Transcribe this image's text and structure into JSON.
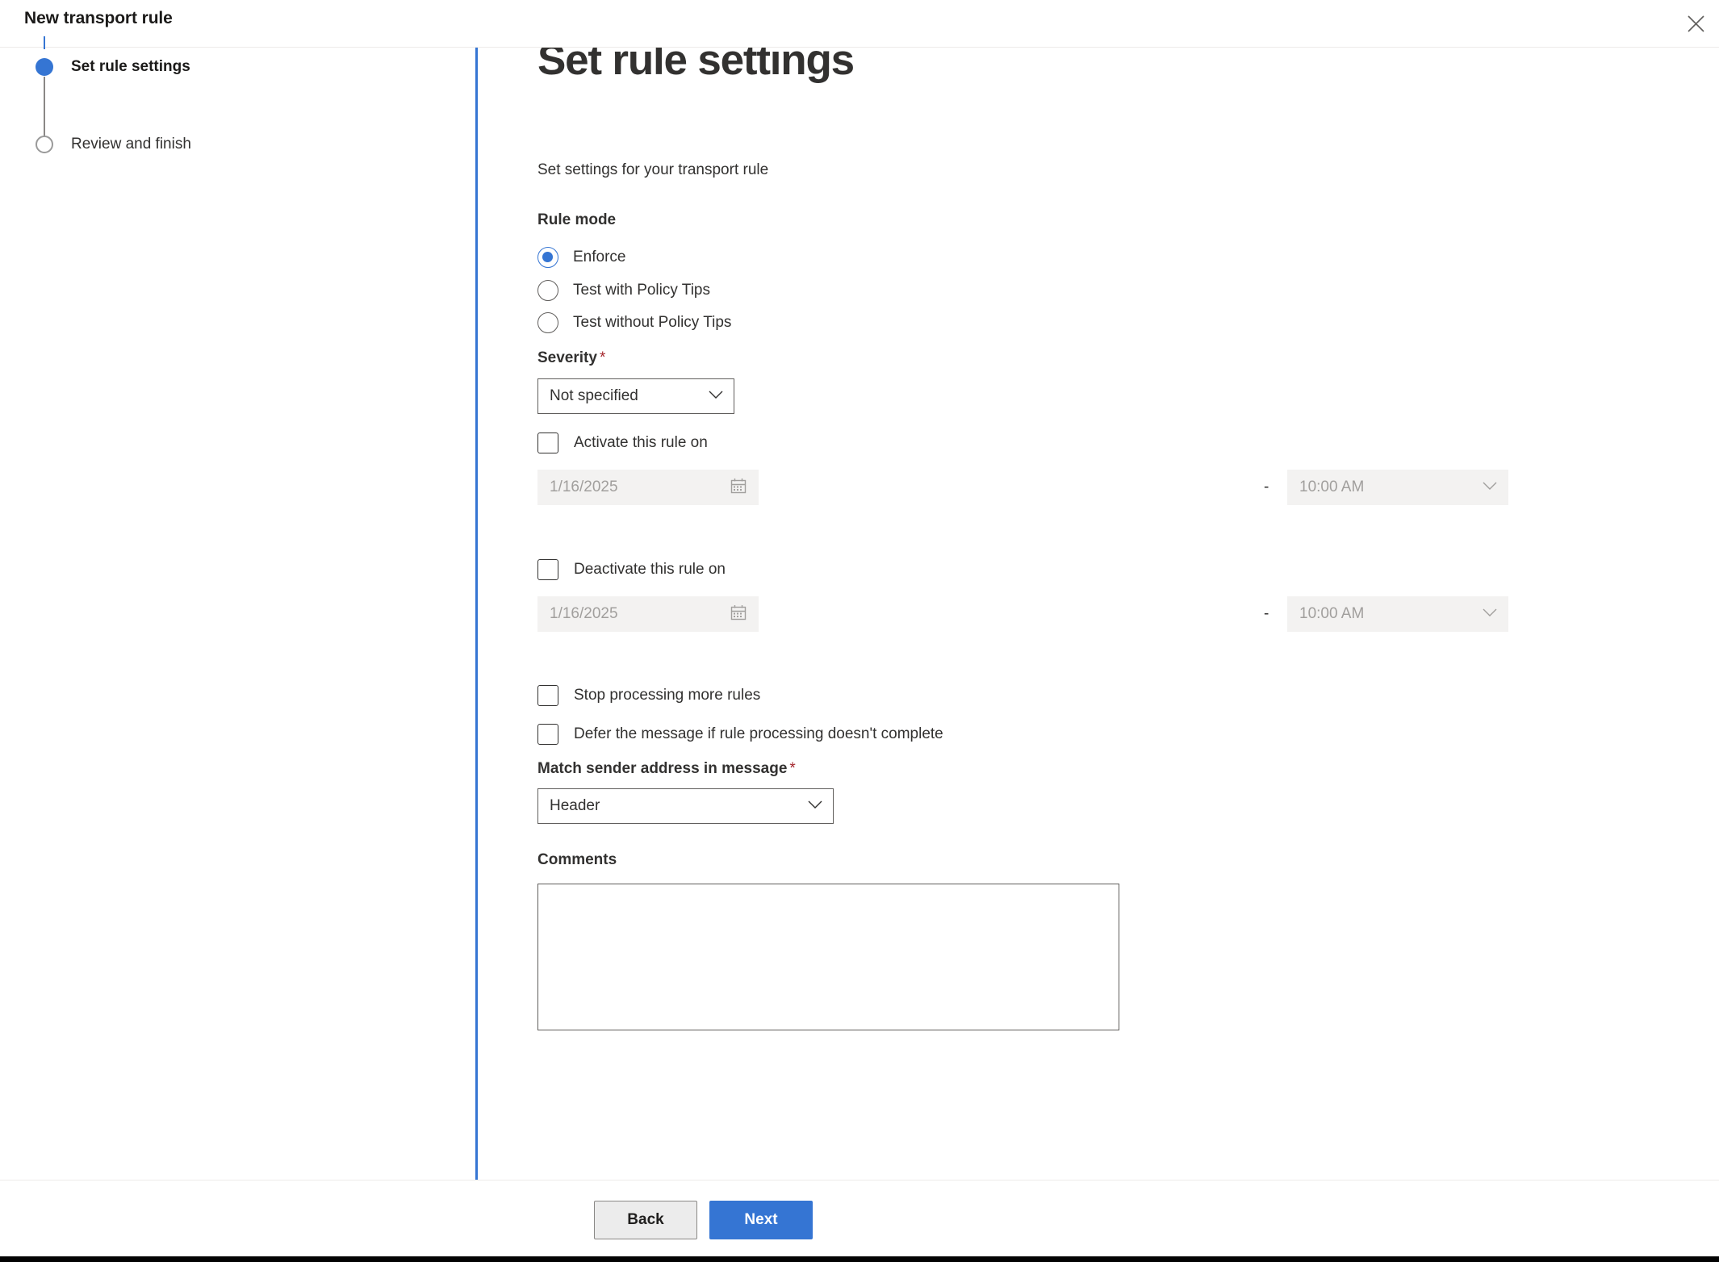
{
  "header": {
    "title": "New transport rule",
    "close_icon": "close-icon"
  },
  "steps": [
    {
      "label": "Set rule settings",
      "state": "active"
    },
    {
      "label": "Review and finish",
      "state": "inactive"
    }
  ],
  "main": {
    "title": "Set rule settings",
    "subtitle": "Set settings for your transport rule",
    "rule_mode": {
      "label": "Rule mode",
      "options": [
        {
          "label": "Enforce",
          "selected": true
        },
        {
          "label": "Test with Policy Tips",
          "selected": false
        },
        {
          "label": "Test without Policy Tips",
          "selected": false
        }
      ]
    },
    "severity": {
      "label": "Severity",
      "required_marker": "*",
      "value": "Not specified",
      "chevron_icon": "chevron-down-icon"
    },
    "activate": {
      "checkbox_label": "Activate this rule on",
      "checked": false,
      "date_value": "1/16/2025",
      "calendar_icon": "calendar-icon",
      "separator": "-",
      "time_value": "10:00 AM",
      "chevron_icon": "chevron-down-icon"
    },
    "deactivate": {
      "checkbox_label": "Deactivate this rule on",
      "checked": false,
      "date_value": "1/16/2025",
      "calendar_icon": "calendar-icon",
      "separator": "-",
      "time_value": "10:00 AM",
      "chevron_icon": "chevron-down-icon"
    },
    "stop_processing": {
      "label": "Stop processing more rules",
      "checked": false
    },
    "defer_message": {
      "label": "Defer the message if rule processing doesn't complete",
      "checked": false
    },
    "match_sender": {
      "label": "Match sender address in message",
      "required_marker": "*",
      "value": "Header",
      "chevron_icon": "chevron-down-icon"
    },
    "comments": {
      "label": "Comments",
      "value": "",
      "placeholder": ""
    }
  },
  "footer": {
    "back_label": "Back",
    "next_label": "Next"
  },
  "colors": {
    "accent": "#3575d3",
    "required": "#a4262c",
    "disabled_bg": "#f3f2f1",
    "disabled_text": "#a19f9d"
  }
}
